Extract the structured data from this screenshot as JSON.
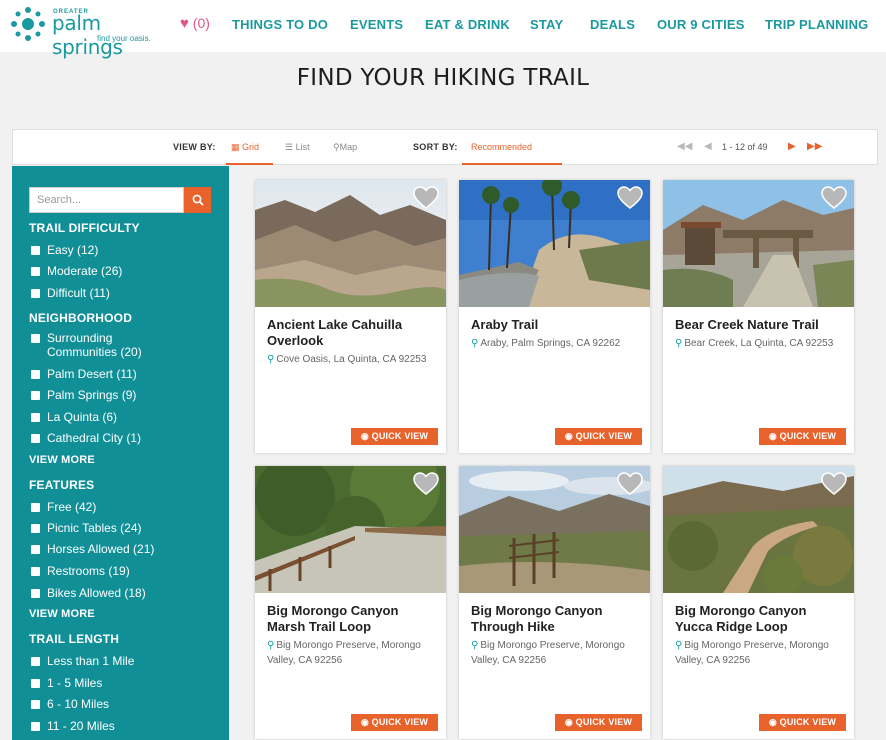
{
  "logo": {
    "greater": "GREATER",
    "name": "palm springs",
    "tagline": "find your oasis."
  },
  "favorites": {
    "count": "(0)"
  },
  "nav": [
    "THINGS TO DO",
    "EVENTS",
    "EAT & DRINK",
    "STAY",
    "DEALS",
    "OUR 9 CITIES",
    "TRIP PLANNING"
  ],
  "page_title": "FIND YOUR HIKING TRAIL",
  "toolbar": {
    "view_by": "VIEW BY:",
    "views": [
      "Grid",
      "List",
      "Map"
    ],
    "sort_by": "SORT BY:",
    "sort_value": "Recommended",
    "pager": "1 - 12 of 49"
  },
  "sidebar": {
    "search_placeholder": "Search...",
    "sections": [
      {
        "title": "TRAIL DIFFICULTY",
        "items": [
          "Easy (12)",
          "Moderate (26)",
          "Difficult (11)"
        ]
      },
      {
        "title": "NEIGHBORHOOD",
        "items": [
          "Surrounding Communities (20)",
          "Palm Desert (11)",
          "Palm Springs (9)",
          "La Quinta (6)",
          "Cathedral City (1)"
        ],
        "more": "VIEW MORE"
      },
      {
        "title": "FEATURES",
        "items": [
          "Free (42)",
          "Picnic Tables (24)",
          "Horses Allowed (21)",
          "Restrooms (19)",
          "Bikes Allowed (18)"
        ],
        "more": "VIEW MORE"
      },
      {
        "title": "TRAIL LENGTH",
        "items": [
          "Less than 1 Mile",
          "1 - 5 Miles",
          "6 - 10 Miles",
          "11 - 20 Miles"
        ]
      }
    ]
  },
  "quick_view": "QUICK VIEW",
  "cards": [
    {
      "title": "Ancient Lake Cahuilla Overlook",
      "address": "Cove Oasis, La Quinta, CA 92253"
    },
    {
      "title": "Araby Trail",
      "address": "Araby, Palm Springs, CA 92262"
    },
    {
      "title": "Bear Creek Nature Trail",
      "address": "Bear Creek, La Quinta, CA 92253"
    },
    {
      "title": "Big Morongo Canyon Marsh Trail Loop",
      "address": "Big Morongo Preserve, Morongo Valley, CA 92256"
    },
    {
      "title": "Big Morongo Canyon Through Hike",
      "address": "Big Morongo Preserve, Morongo Valley, CA 92256"
    },
    {
      "title": "Big Morongo Canyon Yucca Ridge Loop",
      "address": "Big Morongo Preserve, Morongo Valley, CA 92256"
    }
  ],
  "colors": {
    "teal": "#118f97",
    "orange": "#e8622c",
    "pink": "#e0568a"
  }
}
